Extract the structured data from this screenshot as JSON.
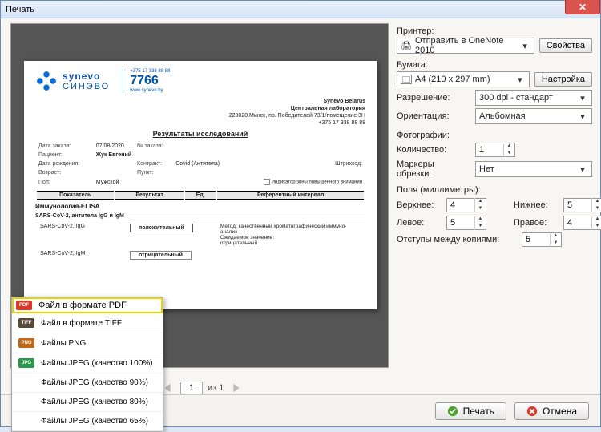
{
  "window": {
    "title": "Печать"
  },
  "printer": {
    "label": "Принтер:",
    "selected": "Отправить в OneNote 2010",
    "properties_btn": "Свойства"
  },
  "paper": {
    "label": "Бумага:",
    "selected": "A4 (210 x 297 mm)",
    "settings_btn": "Настройка"
  },
  "resolution": {
    "label": "Разрешение:",
    "value": "300 dpi - стандарт"
  },
  "orientation": {
    "label": "Ориентация:",
    "value": "Альбомная"
  },
  "photos": {
    "label": "Фотографии:",
    "count_label": "Количество:",
    "count_value": "1",
    "crop_label": "Маркеры обрезки:",
    "crop_value": "Нет"
  },
  "margins": {
    "label": "Поля (миллиметры):",
    "top_label": "Верхнее:",
    "top": "4",
    "bottom_label": "Нижнее:",
    "bottom": "5",
    "left_label": "Левое:",
    "left": "5",
    "right_label": "Правое:",
    "right": "4"
  },
  "copy_gap": {
    "label": "Отступы между копиями:",
    "value": "5"
  },
  "pager": {
    "page": "1",
    "of_label": "из 1"
  },
  "buttons": {
    "print": "Печать",
    "cancel": "Отмена"
  },
  "export_menu": {
    "items": [
      "Файл в формате PDF",
      "Файл в формате TIFF",
      "Файлы PNG",
      "Файлы JPEG (качество 100%)",
      "Файлы JPEG (качество 90%)",
      "Файлы JPEG (качество 80%)",
      "Файлы JPEG (качество 65%)"
    ]
  },
  "document": {
    "brand_line1": "synevo",
    "brand_line2": "СИНЭВО",
    "phone_small": "+375 17 338 88 88",
    "phone_big": "7766",
    "site": "www.synevo.by",
    "org1": "Synevo Belarus",
    "org2": "Центральная лаборатория",
    "org3": "220020 Минск, пр. Победителей 73/1/помещение 3Н",
    "org4": "+375 17 338 88 88",
    "title": "Результаты исследований",
    "meta": {
      "order_date_l": "Дата заказа:",
      "order_date": "07/08/2020",
      "order_no_l": "№ заказа:",
      "patient_l": "Пациент:",
      "patient": "Жук Евгений",
      "dob_l": "Дата рождения:",
      "contract_l": "Контракт:",
      "contract": "Covid (Антитела)",
      "barcode_l": "Штрихкод:",
      "age_l": "Возраст:",
      "point_l": "Пункт:",
      "sex_l": "Пол:",
      "sex": "Мужской",
      "note": "Индикатор зоны повышенного внимания"
    },
    "thead": {
      "c1": "Показатель",
      "c2": "Результат",
      "c3": "Ед.",
      "c4": "Референтный интервал"
    },
    "section": "Иммунология-ELISA",
    "subsection": "SARS-CoV-2, антитела IgG и IgM",
    "rows": [
      {
        "name": "SARS-CoV-2, IgG",
        "result": "положительный",
        "note": "Метод: качественный хроматографический иммуно-\nанализ\nОжидаемое значение:\nотрицательный"
      },
      {
        "name": "SARS-CoV-2, IgM",
        "result": "отрицательный",
        "note": ""
      }
    ]
  }
}
